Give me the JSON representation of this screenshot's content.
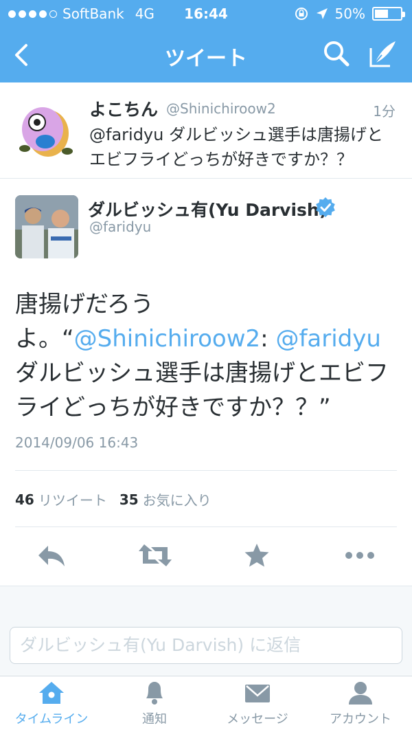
{
  "status_bar": {
    "carrier": "SoftBank",
    "network": "4G",
    "time": "16:44",
    "battery_text": "50%",
    "battery_level": 0.5
  },
  "nav": {
    "title": "ツイート"
  },
  "reply_tweet": {
    "name": "よこちん",
    "handle": "@Shinichiroow2",
    "time": "1分",
    "text": "@faridyu ダルビッシュ選手は唐揚げとエビフライどっちが好きですか？？"
  },
  "main_tweet": {
    "name": "ダルビッシュ有(Yu Darvish)",
    "handle": "@faridyu",
    "text_part1": "唐揚げだろうよ。“",
    "mention1": "@Shinichiroow2",
    "text_part2": ": ",
    "mention2": "@faridyu",
    "text_part3": " ダルビッシュ選手は唐揚げとエビフライどっちが好きですか？？”",
    "date": "2014/09/06 16:43",
    "retweet_count": "46",
    "retweet_label": "リツイート",
    "favorite_count": "35",
    "favorite_label": "お気に入り"
  },
  "reply_box": {
    "placeholder": "ダルビッシュ有(Yu Darvish) に返信"
  },
  "tabs": [
    {
      "label": "タイムライン",
      "icon": "home-icon"
    },
    {
      "label": "通知",
      "icon": "bell-icon"
    },
    {
      "label": "メッセージ",
      "icon": "envelope-icon"
    },
    {
      "label": "アカウント",
      "icon": "person-icon"
    }
  ],
  "colors": {
    "brand": "#55acee",
    "text": "#292f33",
    "muted": "#8899a6"
  }
}
